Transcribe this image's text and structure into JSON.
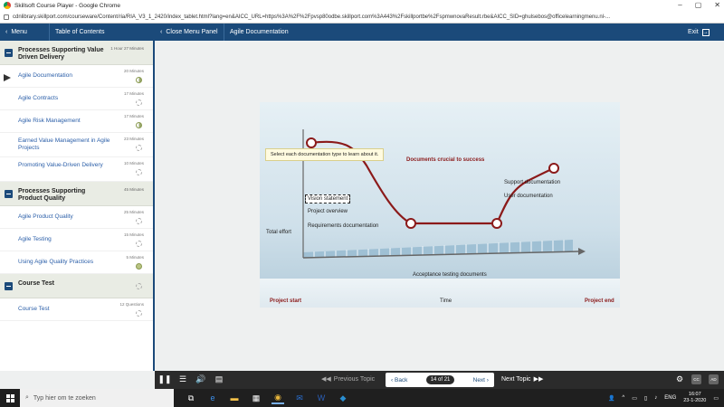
{
  "browser": {
    "title": "Skillsoft Course Player - Google Chrome",
    "url": "cdnlibrary.skillport.com/courseware/Content/ria/RIA_V3_1_2420/index_tablet.html?lang=en&AICC_URL=https%3A%2F%2Fpvsp80odbe.skillport.com%3A443%2Fskillportbe%2FspmwnovaResult.rbe&AICC_SID=ghulsebos@officelearningmenu.nl-..."
  },
  "appbar": {
    "menu_label": "Menu",
    "toc_label": "Table of Contents",
    "close_menu_label": "Close Menu Panel",
    "page_title": "Agile Documentation",
    "exit_label": "Exit"
  },
  "sidebar": {
    "sections": [
      {
        "label": "Processes Supporting Value Driven Delivery",
        "duration": "1 Hour 27 Minutes",
        "items": [
          {
            "label": "Agile Documentation",
            "duration": "20 Minutes",
            "status": "partial"
          },
          {
            "label": "Agile Contracts",
            "duration": "17 Minutes",
            "status": "not-started"
          },
          {
            "label": "Agile Risk Management",
            "duration": "17 Minutes",
            "status": "partial"
          },
          {
            "label": "Earned Value Management in Agile Projects",
            "duration": "23 Minutes",
            "status": "not-started"
          },
          {
            "label": "Promoting Value-Driven Delivery",
            "duration": "10 Minutes",
            "status": "not-started"
          }
        ]
      },
      {
        "label": "Processes Supporting Product Quality",
        "duration": "45 Minutes",
        "items": [
          {
            "label": "Agile Product Quality",
            "duration": "25 Minutes",
            "status": "not-started"
          },
          {
            "label": "Agile Testing",
            "duration": "15 Minutes",
            "status": "not-started"
          },
          {
            "label": "Using Agile Quality Practices",
            "duration": "5 Minutes",
            "status": "complete"
          }
        ]
      },
      {
        "label": "Course Test",
        "duration": "",
        "items": [
          {
            "label": "Course Test",
            "duration": "12 Questions",
            "status": "not-started"
          }
        ]
      }
    ]
  },
  "slide": {
    "instruction": "Select each documentation type to learn about it.",
    "title": "Documents crucial to success",
    "y_axis_label": "Total effort",
    "x_axis_label": "Time",
    "x_start_label": "Project start",
    "x_end_label": "Project end",
    "labels": {
      "vision": "Vision statement",
      "overview": "Project overview",
      "requirements": "Requirements documentation",
      "acceptance": "Acceptance testing documents",
      "support": "Support documentation",
      "user": "User documentation"
    },
    "curve_color": "#8b1a1a"
  },
  "player": {
    "prev_topic": "Previous Topic",
    "back": "Back",
    "page_indicator": "14 of 21",
    "next": "Next",
    "next_topic": "Next Topic",
    "cc_label": "CC",
    "ad_label": "AD"
  },
  "taskbar": {
    "search_placeholder": "Typ hier om te zoeken",
    "lang": "ENG",
    "time": "16:07",
    "date": "23-1-2020"
  }
}
